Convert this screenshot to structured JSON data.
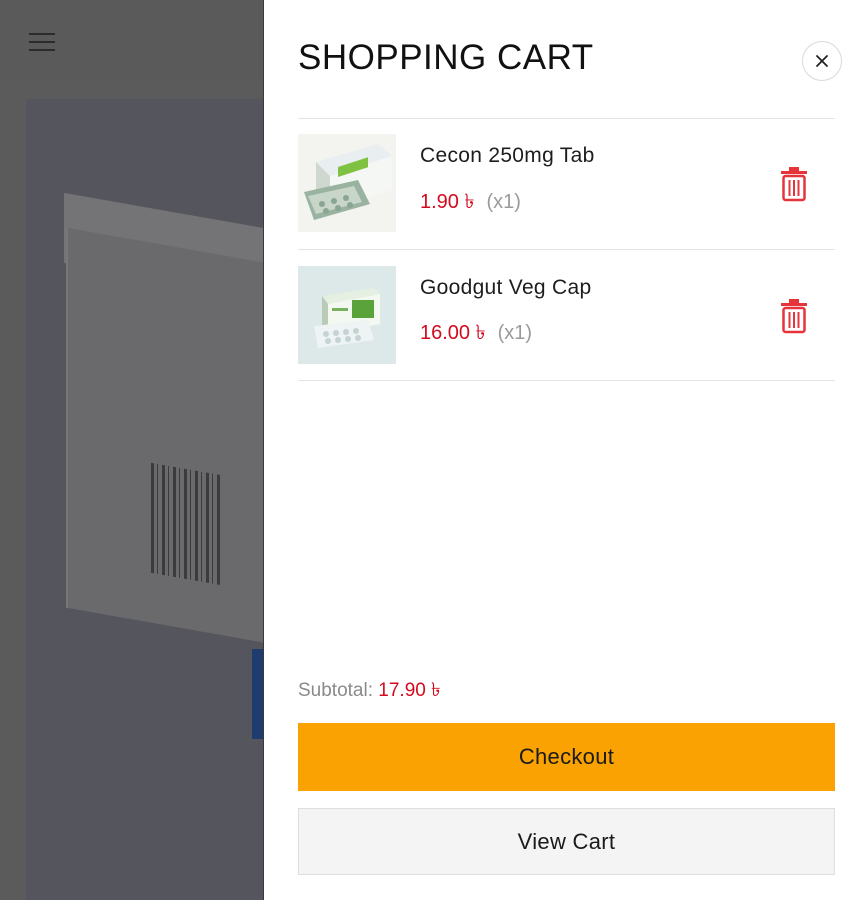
{
  "background": {
    "menu_icon": "hamburger-icon"
  },
  "cart": {
    "title": "SHOPPING CART",
    "close_icon": "close-icon",
    "items": [
      {
        "name": "Cecon 250mg Tab",
        "price": "1.90 ৳",
        "qty": "(x1)",
        "thumb_icon": "medicine-box-image",
        "delete_icon": "trash-icon"
      },
      {
        "name": "Goodgut Veg Cap",
        "price": "16.00 ৳",
        "qty": "(x1)",
        "thumb_icon": "medicine-box-image",
        "delete_icon": "trash-icon"
      }
    ],
    "subtotal_label": "Subtotal:",
    "subtotal_value": "17.90 ৳",
    "checkout_label": "Checkout",
    "view_cart_label": "View Cart"
  },
  "colors": {
    "accent": "#f9a201",
    "price": "#d40b1f",
    "overlay": "#5b5b5b"
  }
}
